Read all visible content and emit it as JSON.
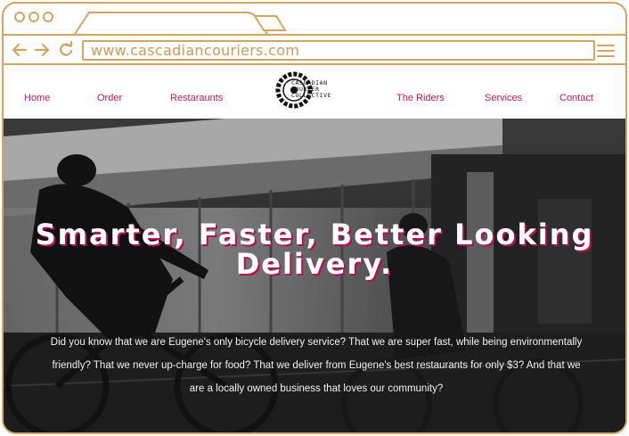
{
  "browser": {
    "url": "www.cascadiancouriers.com",
    "icons": [
      "back-arrow-icon",
      "forward-arrow-icon",
      "reload-icon",
      "hamburger-menu-icon"
    ],
    "frame_color": "#d4a462"
  },
  "nav": {
    "items": [
      {
        "label": "Home"
      },
      {
        "label": "Order"
      },
      {
        "label": "Restaraunts"
      },
      {
        "label": "The Riders"
      },
      {
        "label": "Services"
      },
      {
        "label": "Contact"
      }
    ],
    "link_color": "#c2185b"
  },
  "logo": {
    "line1": "CASCADIAN",
    "line2": "COURIER",
    "line3": "COLLECTIVE"
  },
  "hero": {
    "title_line1": "Smarter, Faster, Better Looking",
    "title_line2": "Delivery.",
    "body": "Did you know that we are Eugene's only bicycle delivery service? That we are super fast, while being environmentally friendly? That we never up-charge for food? That we deliver from Eugene's best restaurants for only $3?  And that we are a locally owned business that loves our community?",
    "title_shadow_color": "#b3114f"
  }
}
